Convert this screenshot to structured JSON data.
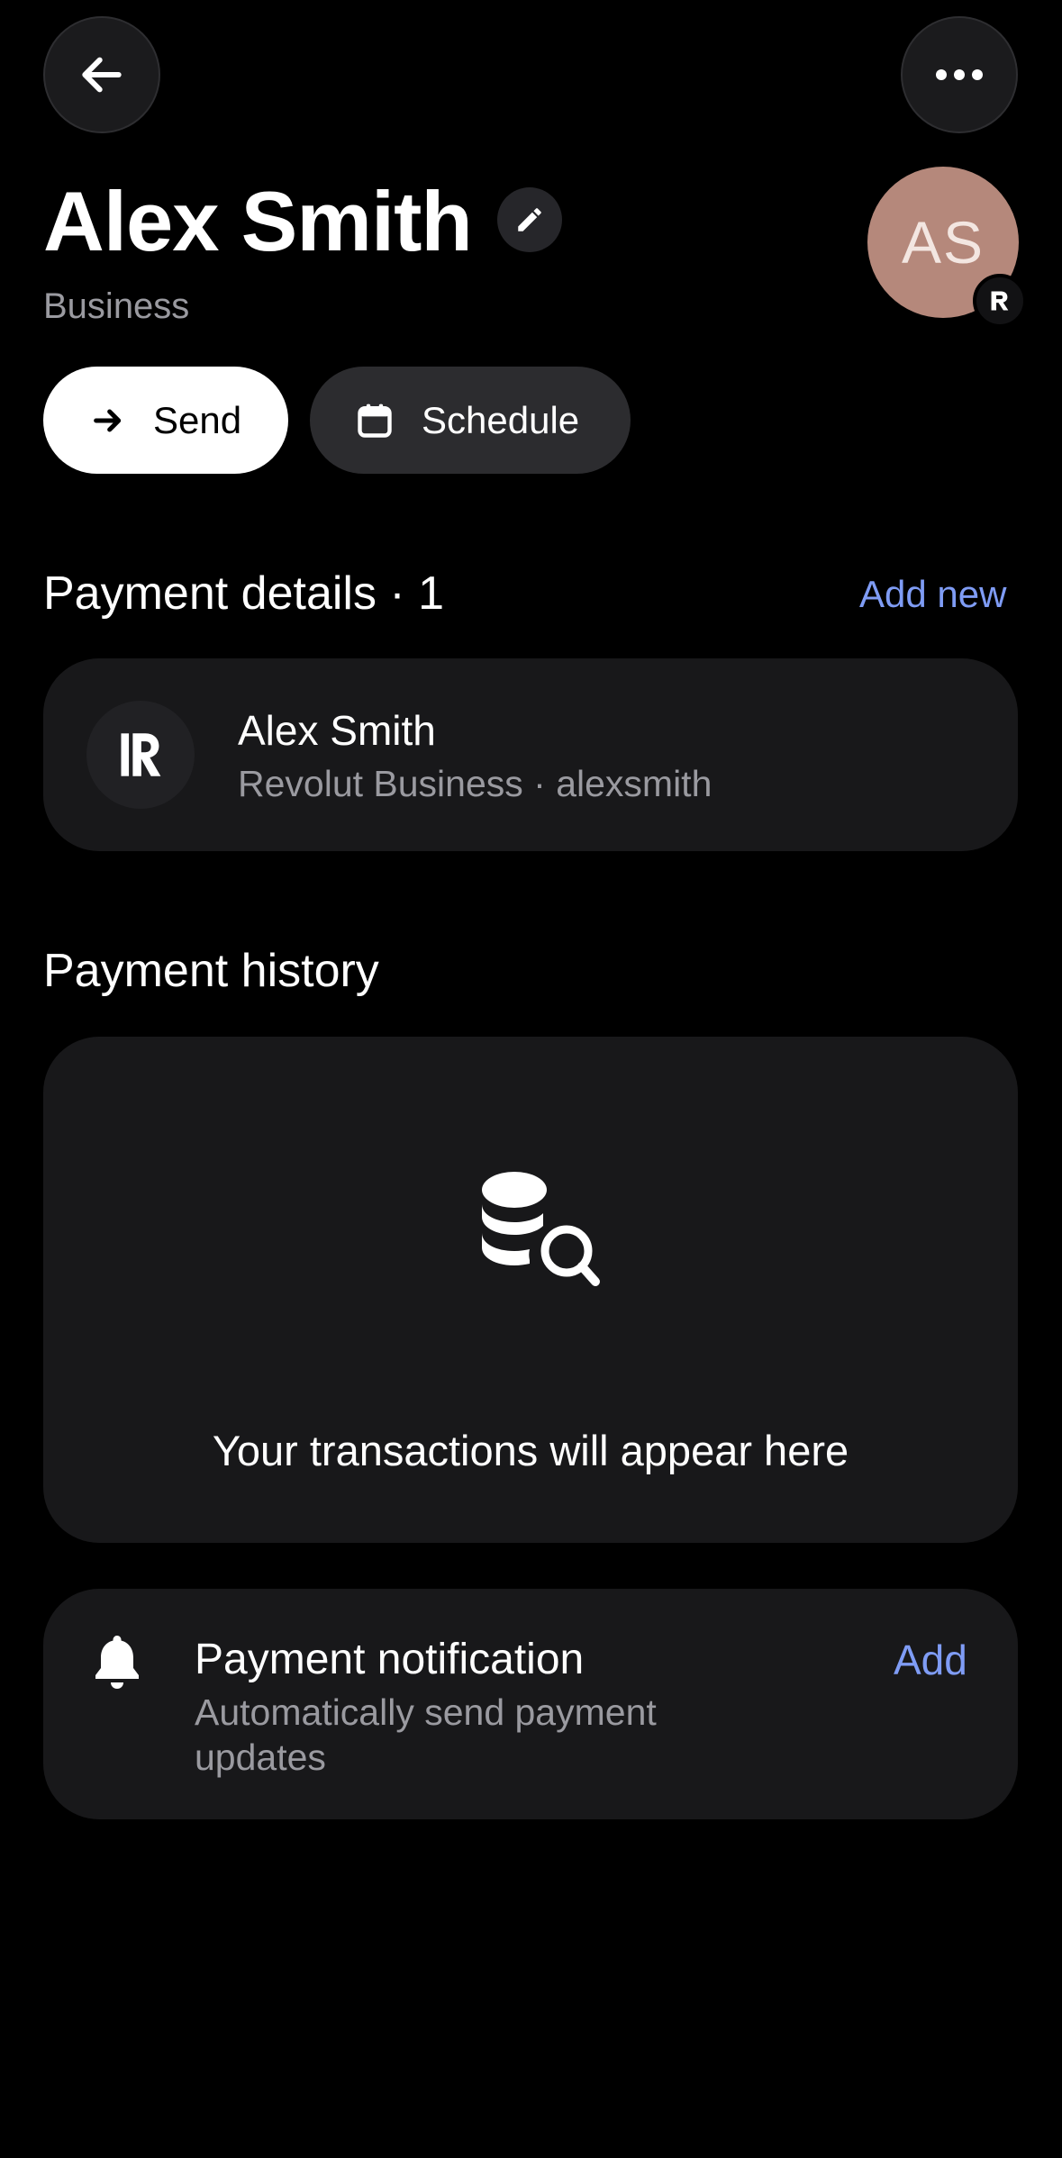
{
  "header": {
    "back_icon": "arrow-left-icon",
    "more_icon": "more-horizontal-icon"
  },
  "profile": {
    "name": "Alex Smith",
    "type": "Business",
    "avatar_initials": "AS",
    "avatar_color": "#b5887b",
    "edit_icon": "pencil-icon",
    "badge_icon": "revolut-logo-icon"
  },
  "actions": {
    "send_label": "Send",
    "send_icon": "arrow-right-icon",
    "schedule_label": "Schedule",
    "schedule_icon": "calendar-icon"
  },
  "payment_details": {
    "title": "Payment details · 1",
    "add_new_label": "Add new",
    "items": [
      {
        "name": "Alex Smith",
        "subtitle": "Revolut Business · alexsmith",
        "icon": "revolut-logo-icon"
      }
    ]
  },
  "payment_history": {
    "title": "Payment history",
    "empty_icon": "coins-search-icon",
    "empty_text": "Your transactions will appear here"
  },
  "notification": {
    "icon": "bell-icon",
    "title": "Payment notification",
    "subtitle": "Automatically send payment updates",
    "add_label": "Add"
  },
  "colors": {
    "background": "#000000",
    "card": "#18181a",
    "accent_link": "#7f9cf5",
    "secondary_text": "#9a9aa0"
  }
}
